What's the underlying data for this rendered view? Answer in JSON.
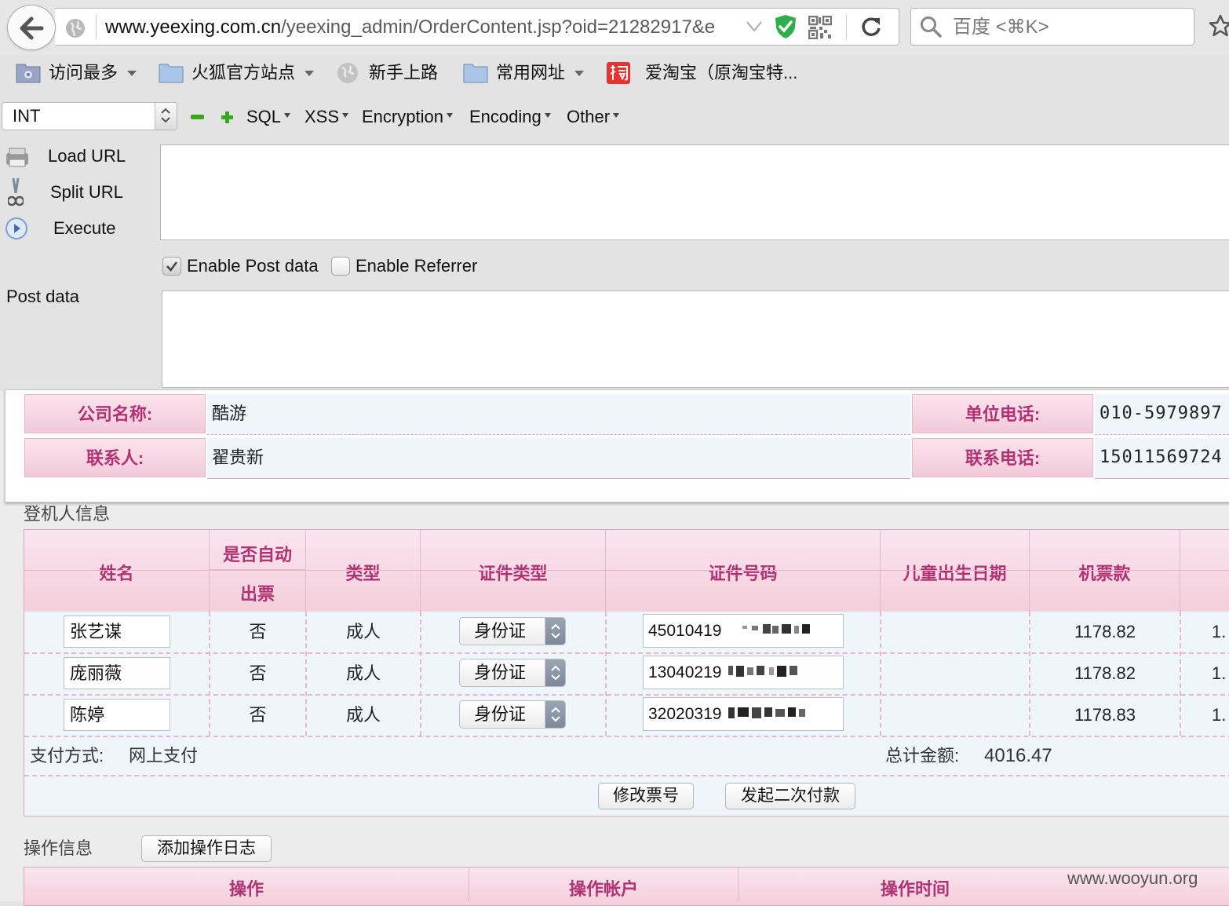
{
  "browser": {
    "url_domain": "www.yeexing.com.cn",
    "url_path": "/yeexing_admin/OrderContent.jsp?oid=21282917&e",
    "search_placeholder": "百度 <⌘K>"
  },
  "bookmarks": [
    {
      "label": "访问最多",
      "icon": "smart-folder-icon"
    },
    {
      "label": "火狐官方站点",
      "icon": "folder-icon"
    },
    {
      "label": "新手上路",
      "icon": "globe-icon"
    },
    {
      "label": "常用网址",
      "icon": "folder-icon"
    },
    {
      "label": "爱淘宝（原淘宝特...",
      "icon": "taobao-icon"
    }
  ],
  "hackbar": {
    "select_value": "INT",
    "menus": [
      "SQL",
      "XSS",
      "Encryption",
      "Encoding",
      "Other"
    ],
    "actions": [
      "Load URL",
      "Split URL",
      "Execute"
    ],
    "enable_post": "Enable Post data",
    "enable_referrer": "Enable Referrer",
    "post_label": "Post data",
    "post_checked": true,
    "referrer_checked": false
  },
  "company": {
    "name_label": "公司名称:",
    "name_value": "酷游",
    "phone_label": "单位电话:",
    "phone_value": "010-5979897",
    "contact_label": "联系人:",
    "contact_value": "翟贵新",
    "contact_phone_label": "联系电话:",
    "contact_phone_value": "15011569724"
  },
  "passengers": {
    "title": "登机人信息",
    "headers": {
      "name": "姓名",
      "auto_ticket_1": "是否自动",
      "auto_ticket_2": "出票",
      "type": "类型",
      "id_type": "证件类型",
      "id_number": "证件号码",
      "child_dob": "儿童出生日期",
      "fare": "机票款"
    },
    "rows": [
      {
        "name": "张艺谋",
        "auto": "否",
        "type": "成人",
        "id_type": "身份证",
        "id_number": "45010419",
        "fare": "1178.82",
        "extra": "1."
      },
      {
        "name": "庞丽薇",
        "auto": "否",
        "type": "成人",
        "id_type": "身份证",
        "id_number": "13040219",
        "fare": "1178.82",
        "extra": "1."
      },
      {
        "name": "陈婷",
        "auto": "否",
        "type": "成人",
        "id_type": "身份证",
        "id_number": "32020319",
        "fare": "1178.83",
        "extra": "1."
      }
    ],
    "pay_method_label": "支付方式:",
    "pay_method_value": "网上支付",
    "total_label": "总计金额:",
    "total_value": "4016.47",
    "btn_modify": "修改票号",
    "btn_second_pay": "发起二次付款"
  },
  "operations": {
    "title": "操作信息",
    "add_log": "添加操作日志",
    "headers": [
      "操作",
      "操作帐户",
      "操作时间"
    ]
  },
  "watermark": "www.wooyun.org"
}
